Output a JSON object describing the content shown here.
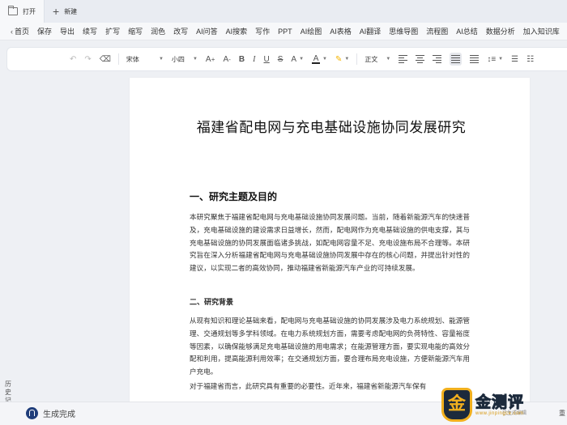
{
  "tabs": [
    {
      "label": "打开",
      "icon": "folder-icon"
    },
    {
      "label": "新建",
      "icon": "plus-icon"
    }
  ],
  "menubar": {
    "back_label": "首页",
    "items": [
      "保存",
      "导出",
      "续写",
      "扩写",
      "缩写",
      "润色",
      "改写",
      "AI问答",
      "AI搜索",
      "写作",
      "PPT",
      "AI绘图",
      "AI表格",
      "AI翻译",
      "思维导图",
      "流程图",
      "AI总结",
      "数据分析",
      "加入知识库"
    ]
  },
  "toolbar": {
    "font_family": "宋体",
    "font_size": "小四",
    "grow_font": "A",
    "shrink_font": "A",
    "bold": "B",
    "italic": "I",
    "underline": "U",
    "strike": "S",
    "case": "A",
    "font_color_glyph": "A",
    "paragraph_style": "正文",
    "font_color": "#222222",
    "highlight_color": "#f5d43a"
  },
  "document": {
    "title": "福建省配电网与充电基础设施协同发展研究",
    "heading1": "一、研究主题及目的",
    "para1": "本研究聚焦于福建省配电网与充电基础设施协同发展问题。当前，随着新能源汽车的快速普及，充电基础设施的建设需求日益增长，然而，配电网作为充电基础设施的供电支撑，其与充电基础设施的协同发展面临诸多挑战，如配电网容量不足、充电设施布局不合理等。本研究旨在深入分析福建省配电网与充电基础设施协同发展中存在的核心问题，并提出针对性的建议，以实现二者的高效协同，推动福建省新能源汽车产业的可持续发展。",
    "heading2": "二、研究背景",
    "para2": "从现有知识和理论基础来看，配电网与充电基础设施的协同发展涉及电力系统规划、能源管理、交通规划等多学科领域。在电力系统规划方面，需要考虑配电网的负荷特性、容量裕度等因素，以确保能够满足充电基础设施的用电需求；在能源管理方面，要实现电能的高效分配和利用，提高能源利用效率；在交通规划方面，要合理布局充电设施，方便新能源汽车用户充电。",
    "para3": "对于福建省而言，此研究具有重要的必要性。近年来，福建省新能源汽车保有"
  },
  "sidebar": {
    "history_label": "历史记录"
  },
  "status": {
    "generation": "生成完成",
    "action1": "重",
    "action1_sub": "已生成编辑"
  },
  "watermark": {
    "badge": "金",
    "main": "金测评",
    "sub": "www.jinpingce.com"
  }
}
